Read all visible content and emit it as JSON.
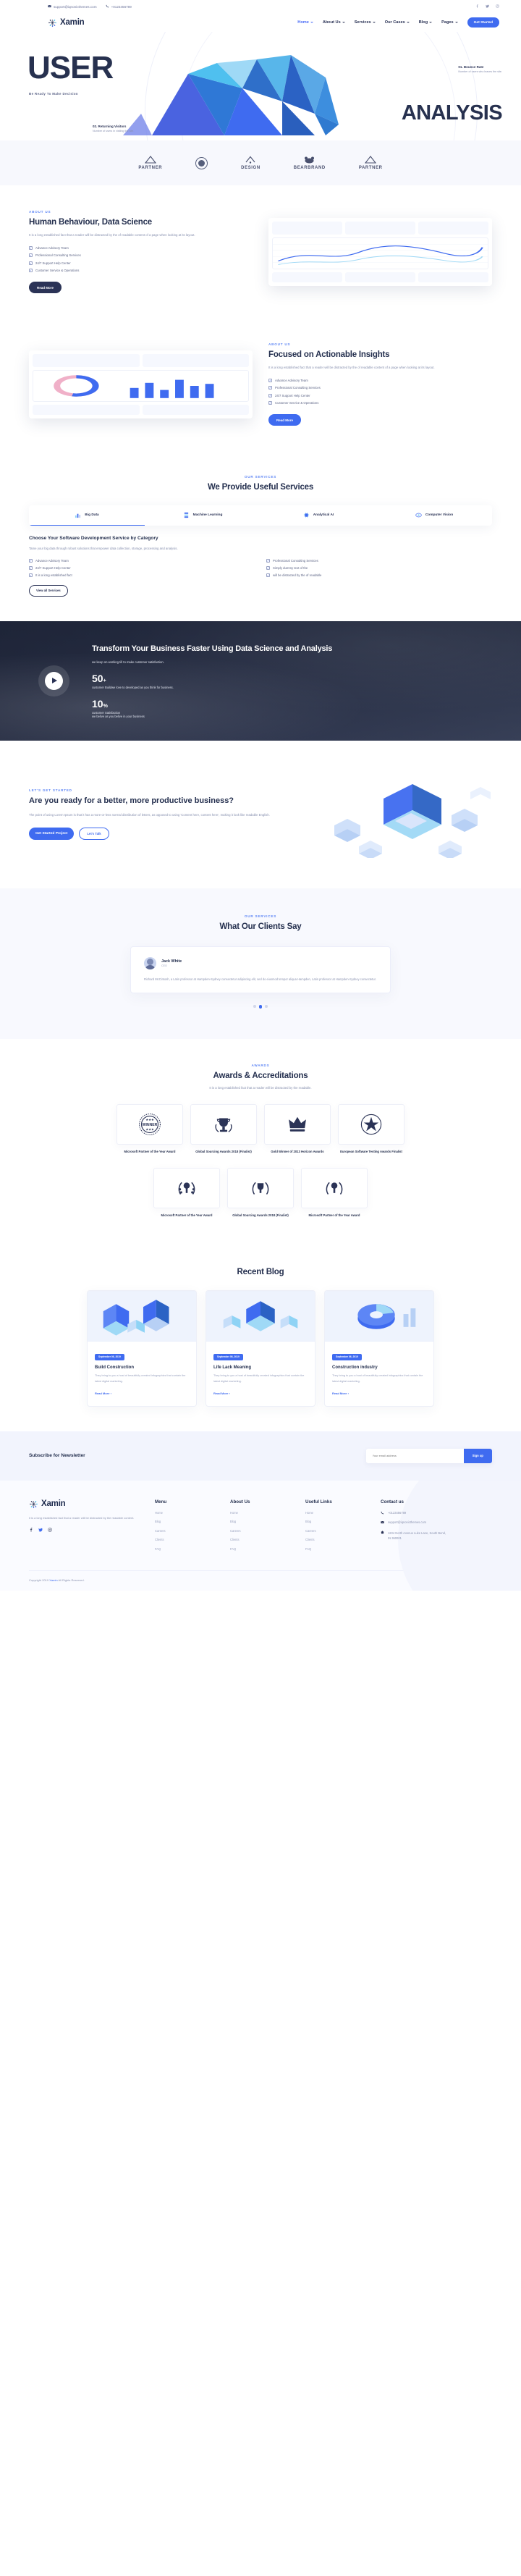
{
  "topbar": {
    "email": "support@iqnonicthemes.com",
    "phone": "+0123456789",
    "mail_icon": "mail-icon",
    "phone_icon": "phone-icon",
    "socials": [
      "facebook-icon",
      "twitter-icon",
      "instagram-icon"
    ]
  },
  "header": {
    "brand": "Xamin",
    "nav": [
      {
        "label": "Home",
        "active": true
      },
      {
        "label": "About Us",
        "active": false
      },
      {
        "label": "Services",
        "active": false
      },
      {
        "label": "Our Cases",
        "active": false
      },
      {
        "label": "Blog",
        "active": false
      },
      {
        "label": "Pages",
        "active": false
      }
    ],
    "cta": "Get Started"
  },
  "hero": {
    "title_top": "USER",
    "title_bottom": "ANALYSIS",
    "subtitle": "Be Ready To Make Decision",
    "callout_right": {
      "title": "01. Bounce Rate",
      "desc": "Number of users who leaves the site."
    },
    "callout_left": {
      "title": "02. Returning Visitors",
      "desc": "Number of users in visiting the site."
    }
  },
  "partners": [
    {
      "name": "PARTNER",
      "sub": "+",
      "type": "text"
    },
    {
      "name": "",
      "sub": "",
      "type": "badge"
    },
    {
      "name": "DESIGN",
      "sub": "+",
      "type": "text"
    },
    {
      "name": "BEARBRAND",
      "sub": "+",
      "type": "cloud"
    },
    {
      "name": "PARTNER",
      "sub": "+",
      "type": "text"
    }
  ],
  "about1": {
    "eyebrow": "ABOUT US",
    "title": "Human Behaviour, Data Science",
    "para": "It is a long established fact that a reader will be distracted by the of readable content of a page when looking at its layout.",
    "checks": [
      "Advance Advisory Team",
      "Professional Consulting Services",
      "24/7 Support Help Center",
      "Customer Service & Operations"
    ],
    "button": "Read More"
  },
  "about2": {
    "eyebrow": "ABOUT US",
    "title": "Focused on Actionable Insights",
    "para": "It is a long established fact that a reader will be distracted by the of readable content of a page when looking at its layout.",
    "checks": [
      "Advance Advisory Team",
      "Professional Consulting Services",
      "24/7 Support Help Center",
      "Customer Service & Operations"
    ],
    "button": "Read More"
  },
  "services": {
    "eyebrow": "OUR SERVICES",
    "title": "We Provide Useful Services",
    "tabs": [
      {
        "label": "Big Data",
        "icon": "bars-icon",
        "active": true
      },
      {
        "label": "Machine Learning",
        "icon": "server-icon",
        "active": false
      },
      {
        "label": "Analytical AI",
        "icon": "chip-icon",
        "active": false
      },
      {
        "label": "Computer Vision",
        "icon": "eye-icon",
        "active": false
      }
    ],
    "panel_title": "Choose Your Software Development Service by Category",
    "panel_para": "Tame your big data through robust solutions that empower data collection, storage, processing and analysis.",
    "panel_checks": [
      "Advance Advisory Team",
      "Professional Consulting Services",
      "24/7 Support Help Center",
      "Simply dummy text of the",
      "It is a long established fact",
      "will be distracted by the of readable"
    ],
    "button": "View all Services"
  },
  "video": {
    "title": "Transform Your Business Faster Using Data Science and Analysis",
    "subtitle": "we keep on working till to make customer satisfaction.",
    "play_icon": "play-icon",
    "stats": [
      {
        "number": "50",
        "unit": "+",
        "desc": "customer Buildwe love to developed as you think for business."
      },
      {
        "number": "10",
        "unit": "%",
        "desc": "customer Satisfaction\nwe belive as you belive in your business"
      }
    ]
  },
  "cta": {
    "eyebrow": "LET'S GET STARTED",
    "title": "Are you ready for a better, more productive business?",
    "para": "The point of using Lorem Ipsum is that it has a more-or-less normal distribution of letters, as opposed to using 'Content here, content here', making it look like readable English.",
    "primary": "Get Started Project",
    "secondary": "Let's Talk"
  },
  "testimonials": {
    "eyebrow": "OUR SERVICES",
    "title": "What Our Clients Say",
    "item": {
      "name": "Jack White",
      "role": "CEO",
      "quote": "Richard McCintosh, a Latin professor at Hampden-Sydney consectetur adipiscing elit, sed do eiusmod tempor aliqua Hampden, Latin professor at Hampden-Sydney consectetur.",
      "avatar": "avatar"
    },
    "dots": 3,
    "active_dot": 1
  },
  "awards": {
    "eyebrow": "AWARDS",
    "title": "Awards & Accreditations",
    "para": "It is a long established fact that a reader will be distracted by the readable.",
    "row1": [
      {
        "title": "Microsoft Partner of the Year Award",
        "icon": "winner-seal-icon"
      },
      {
        "title": "Global Sourcing Awards 2018 (Finalist)",
        "icon": "trophy-icon"
      },
      {
        "title": "Gold Winner of 2013 Horizon Awards",
        "icon": "crown-icon"
      },
      {
        "title": "European Software Testing Awards Finalist",
        "icon": "star-icon"
      }
    ],
    "row2": [
      {
        "title": "Microsoft Partner of the Year Award",
        "icon": "laurel-icon"
      },
      {
        "title": "Global Sourcing Awards 2018 (Finalist)",
        "icon": "laurel-icon"
      },
      {
        "title": "Microsoft Partner of the Year Award",
        "icon": "laurel-icon"
      }
    ]
  },
  "blog": {
    "title": "Recent Blog",
    "posts": [
      {
        "date": "September 06, 2019",
        "title": "Build Construction",
        "excerpt": "They bring to you a host of beautifully created infographics that contain the latest digital marketing.",
        "more": "Read More",
        "image": "isometric-buildings"
      },
      {
        "date": "September 06, 2019",
        "title": "Life Lack Meaning",
        "excerpt": "They bring to you a host of beautifully created infographics that contain the latest digital marketing.",
        "more": "Read More",
        "image": "isometric-cubes"
      },
      {
        "date": "September 06, 2019",
        "title": "Construction industry",
        "excerpt": "They bring to you a host of beautifully created infographics that contain the latest digital marketing.",
        "more": "Read More",
        "image": "isometric-chart"
      }
    ]
  },
  "newsletter": {
    "title": "Subscribe for Newsletter",
    "placeholder": "Your email address",
    "button": "Sign up"
  },
  "footer": {
    "brand": "Xamin",
    "desc": "it is a long established fact that a reader will be distracted by the readable content.",
    "socials": [
      "facebook-icon",
      "twitter-icon",
      "instagram-icon"
    ],
    "columns": [
      {
        "heading": "Menu",
        "links": [
          "Home",
          "Blog",
          "Careers",
          "Clients",
          "FAQ"
        ]
      },
      {
        "heading": "About Us",
        "links": [
          "Home",
          "Blog",
          "Careers",
          "Clients",
          "FAQ"
        ]
      },
      {
        "heading": "Useful Links",
        "links": [
          "Home",
          "Blog",
          "Careers",
          "Clients",
          "FAQ"
        ]
      }
    ],
    "contact": {
      "heading": "Contact us",
      "phone": "+0123456789",
      "email": "support@iqnonicthemes.com",
      "address": "1234 North Avenue Luke Lane, South Bend, IN 360001"
    },
    "copyright_pre": "Copyright 2019 ",
    "copyright_brand": "Xamin",
    "copyright_post": " All Rights Reserved."
  },
  "colors": {
    "accent": "#3f6bf0",
    "dark": "#25304f",
    "muted": "#8b93b0"
  }
}
